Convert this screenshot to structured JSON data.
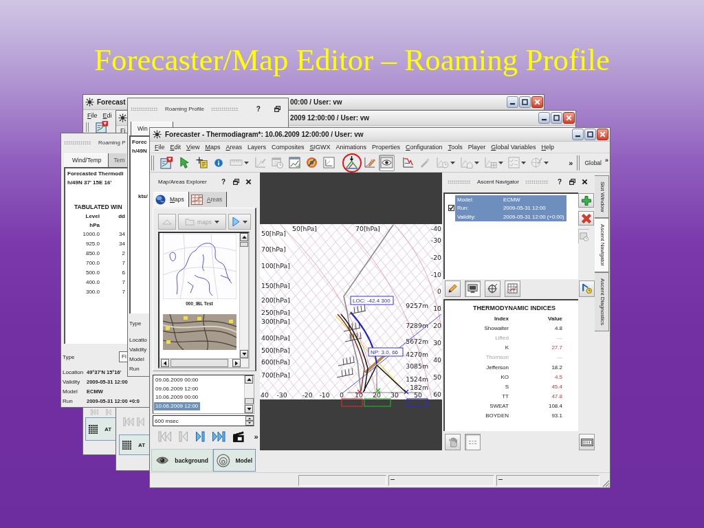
{
  "slide_title": "Forecaster/Map Editor – Roaming Profile",
  "back_windows": [
    {
      "title_start": "Forecast",
      "title_end": "00:00 / User: vw",
      "menu": [
        {
          "label": "File",
          "mnemonic": true
        },
        {
          "label": "Edi",
          "mnemonic": true
        }
      ],
      "player": [
        {
          "kind": "first",
          "disabled": true
        },
        {
          "kind": "prev",
          "disabled": true
        }
      ],
      "panel_button": {
        "label": "AT",
        "selected": true
      }
    },
    {
      "title_end": "2009 12:00:00 / User: vw",
      "menu": [
        {
          "label": "Fi"
        }
      ],
      "player": [
        {
          "kind": "first",
          "disabled": true
        },
        {
          "kind": "prev",
          "disabled": true
        }
      ],
      "panel_button": {
        "label": "AT",
        "selected": true
      }
    }
  ],
  "roaming_profile_left": {
    "title": "Roaming P",
    "tabs": [
      {
        "label": "Wind/Temp",
        "selected": true
      },
      {
        "label": "Tem",
        "selected": false
      }
    ],
    "heading": "Forecasted Thermodi",
    "location": "h/49N 37' 15E 16'",
    "table_title": "TABULATED WIN",
    "columns": [
      {
        "label": "Level",
        "unit": "hPa"
      },
      {
        "label": "dd"
      }
    ],
    "rows": [
      [
        "1000.0",
        "34"
      ],
      [
        "925.0",
        "34"
      ],
      [
        "850.0",
        "2"
      ],
      [
        "700.0",
        "7"
      ],
      [
        "500.0",
        "6"
      ],
      [
        "400.0",
        "7"
      ],
      [
        "300.0",
        "7"
      ]
    ],
    "type": {
      "label": "Type",
      "value": "Fi"
    },
    "details": [
      {
        "label": "Location",
        "value": "49°37'N 15°16'"
      },
      {
        "label": "Validity",
        "value": "2009-05-31 12:00"
      },
      {
        "label": "Model",
        "value": "ECMW"
      },
      {
        "label": "Run",
        "value": "2009-05-31 12:00 +0:0"
      }
    ]
  },
  "roaming_profile_top": {
    "title": "Roaming Profile",
    "help": "?",
    "tab": {
      "label": "Win",
      "selected": true
    },
    "heading": "Forec",
    "location": "h/49N",
    "unit": "kts/",
    "labels": [
      "Type",
      "Locatio",
      "Validity",
      "Model",
      "Run"
    ]
  },
  "main_window": {
    "title": "Forecaster - Thermodiagram*: 10.06.2009 12:00:00 / User: vw",
    "menu": [
      {
        "label": "File",
        "mnemonic": true
      },
      {
        "label": "Edit",
        "mnemonic": true
      },
      {
        "label": "View",
        "mnemonic": true
      },
      {
        "label": "Maps",
        "mnemonic": true
      },
      {
        "label": "Areas",
        "mnemonic": true
      },
      {
        "label": "Layers",
        "mnemonic": false
      },
      {
        "label": "Composites",
        "mnemonic": false
      },
      {
        "label": "SIGWX",
        "mnemonic": true
      },
      {
        "label": "Animations",
        "mnemonic": false
      },
      {
        "label": "Properties",
        "mnemonic": false
      },
      {
        "label": "Configuration",
        "mnemonic": true
      },
      {
        "label": "Tools",
        "mnemonic": true
      },
      {
        "label": "Player",
        "mnemonic": false
      },
      {
        "label": "Global Variables",
        "mnemonic": true
      },
      {
        "label": "Help",
        "mnemonic": true
      }
    ],
    "toolbar": [
      {
        "kind": "map",
        "disabled": false,
        "pressed": false,
        "dropdown": false,
        "highlighted": false
      },
      {
        "kind": "pointer",
        "disabled": false,
        "pressed": false,
        "dropdown": false,
        "highlighted": false
      },
      {
        "kind": "crosshair",
        "disabled": false,
        "pressed": false,
        "dropdown": false,
        "highlighted": false
      },
      {
        "kind": "info",
        "disabled": false,
        "pressed": false,
        "dropdown": false,
        "highlighted": false
      },
      {
        "kind": "ruler",
        "disabled": true,
        "pressed": false,
        "dropdown": true,
        "highlighted": false
      },
      {
        "kind": "sketch",
        "disabled": true,
        "pressed": false,
        "dropdown": false,
        "highlighted": false
      },
      {
        "kind": "calendar",
        "disabled": true,
        "pressed": false,
        "dropdown": false,
        "highlighted": false
      },
      {
        "kind": "window",
        "disabled": false,
        "pressed": false,
        "dropdown": false,
        "highlighted": false
      },
      {
        "kind": "wheel",
        "disabled": false,
        "pressed": false,
        "dropdown": false,
        "highlighted": false
      },
      {
        "kind": "plot",
        "disabled": false,
        "pressed": false,
        "dropdown": false,
        "highlighted": false
      },
      {
        "kind": "ascent",
        "disabled": false,
        "pressed": false,
        "dropdown": false,
        "highlighted": true
      },
      {
        "kind": "pen",
        "disabled": false,
        "pressed": false,
        "dropdown": false,
        "highlighted": false
      },
      {
        "kind": "eye",
        "disabled": false,
        "pressed": true,
        "dropdown": false,
        "highlighted": false
      },
      {
        "kind": "redplot",
        "disabled": false,
        "pressed": false,
        "dropdown": false,
        "highlighted": false
      },
      {
        "kind": "wand",
        "disabled": true,
        "pressed": false,
        "dropdown": false,
        "highlighted": false
      },
      {
        "kind": "clockchart",
        "disabled": true,
        "pressed": false,
        "dropdown": true,
        "highlighted": false
      },
      {
        "kind": "housechart",
        "disabled": true,
        "pressed": false,
        "dropdown": true,
        "highlighted": false
      },
      {
        "kind": "gridchart",
        "disabled": true,
        "pressed": false,
        "dropdown": true,
        "highlighted": false
      },
      {
        "kind": "checklist",
        "disabled": true,
        "pressed": false,
        "dropdown": true,
        "highlighted": false
      },
      {
        "kind": "compass",
        "disabled": true,
        "pressed": false,
        "dropdown": true,
        "highlighted": false
      }
    ],
    "toolbar_overflow": "»",
    "global_toolbar": {
      "label": "Global",
      "overflow": "»"
    },
    "map_explorer": {
      "title": "Map/Areas Explorer",
      "help": "?",
      "tabs": [
        {
          "label": "Maps",
          "kind": "globe",
          "selected": true,
          "mnemonic": true
        },
        {
          "label": "Areas",
          "kind": "areas",
          "selected": false,
          "mnemonic": true
        }
      ],
      "nav_buttons": [
        {
          "kind": "up",
          "disabled": true,
          "dropdown": false
        },
        {
          "kind": "folder",
          "label": "maps",
          "disabled": true,
          "dropdown": true
        },
        {
          "kind": "forward",
          "disabled": false,
          "dropdown": true
        }
      ],
      "thumbnails": [
        {
          "kind": "outline",
          "caption": "000_IBL Test"
        },
        {
          "kind": "terrain"
        }
      ],
      "times": [
        {
          "label": "09.06.2009 00:00",
          "selected": false
        },
        {
          "label": "09.06.2009 12:00",
          "selected": false
        },
        {
          "label": "10.06.2009 00:00",
          "selected": false
        },
        {
          "label": "10.06.2009 12:00",
          "selected": true
        }
      ],
      "interval": "600 msec",
      "player": [
        {
          "kind": "first",
          "disabled": true
        },
        {
          "kind": "prev",
          "disabled": true
        },
        {
          "kind": "next",
          "disabled": false
        },
        {
          "kind": "last",
          "disabled": false
        },
        {
          "kind": "clapper",
          "disabled": false
        }
      ],
      "player_overflow": "»",
      "layers": [
        {
          "label": "background",
          "kind": "eye",
          "selected": false
        },
        {
          "label": "Model",
          "kind": "rings",
          "selected": true
        }
      ]
    },
    "diagram": {
      "top_labels": [
        "50[hPa]",
        "70[hPa]"
      ],
      "pressure_labels": [
        "50[hPa]",
        "70[hPa]",
        "100[hPa]",
        "150[hPa]",
        "200[hPa]",
        "250[hPa]",
        "300[hPa]",
        "400[hPa]",
        "500[hPa]",
        "600[hPa]",
        "700[hPa]"
      ],
      "temperature_labels": [
        "-40",
        "-30",
        "-20",
        "-10",
        "0",
        "10",
        "20",
        "30",
        "40",
        "50",
        "60"
      ],
      "height_labels": [
        "9257m",
        "7289m",
        "5672m",
        "4270m",
        "3085m",
        "1524m",
        "182m"
      ],
      "bottom_labels": [
        "40",
        "-30",
        "-20",
        "-10",
        "0",
        "10",
        "20",
        "30",
        "50"
      ],
      "tags": [
        {
          "label": "LOC: -42.4 300"
        },
        {
          "label": "NP: 3.0, 66"
        }
      ],
      "readouts": [
        {
          "color": "#d03030"
        },
        {
          "color": "#22b022"
        },
        {
          "color": "#2a2ac8"
        }
      ]
    },
    "ascent_navigator": {
      "title": "Ascent Navigator",
      "help": "?",
      "entries": [
        {
          "checked": true,
          "selected": true,
          "rows": [
            {
              "label": "Model:",
              "value": "ECMW"
            },
            {
              "label": "Run:",
              "value": "2009-05-31 12:00"
            },
            {
              "label": "Validity:",
              "value": "2009-05-31 12:00 (+0:00)"
            }
          ]
        }
      ],
      "tools": [
        {
          "kind": "pencil",
          "pressed": false
        },
        {
          "kind": "monitor",
          "pressed": true
        },
        {
          "kind": "target",
          "pressed": false
        },
        {
          "kind": "grid",
          "pressed": false
        }
      ],
      "indices": {
        "title": "THERMODYNAMIC INDICES",
        "columns": [
          "Index",
          "Value"
        ],
        "rows": [
          {
            "index": "Showalter",
            "value": "4.8",
            "unavailable": false,
            "alert": false
          },
          {
            "index": "Lifted",
            "value": "—",
            "unavailable": true,
            "alert": false
          },
          {
            "index": "K",
            "value": "27.7",
            "unavailable": false,
            "alert": true
          },
          {
            "index": "Thomson",
            "value": "—",
            "unavailable": true,
            "alert": false
          },
          {
            "index": "Jefferson",
            "value": "18.2",
            "unavailable": false,
            "alert": false
          },
          {
            "index": "KO",
            "value": "4.5",
            "unavailable": false,
            "alert": true
          },
          {
            "index": "S",
            "value": "45.4",
            "unavailable": false,
            "alert": true
          },
          {
            "index": "TT",
            "value": "47.8",
            "unavailable": false,
            "alert": true
          },
          {
            "index": "SWEAT",
            "value": "108.4",
            "unavailable": false,
            "alert": false
          },
          {
            "index": "BOYDEN",
            "value": "93.1",
            "unavailable": false,
            "alert": false
          }
        ]
      },
      "bottom_tools": [
        {
          "kind": "hand",
          "pressed": false
        },
        {
          "kind": "dots",
          "pressed": true
        }
      ]
    },
    "side_tabs": [
      {
        "label": "Slot Window",
        "selected": false
      },
      {
        "label": "Ascent Navigator",
        "selected": true
      },
      {
        "label": "Ascent Diagnostics",
        "selected": false
      }
    ]
  }
}
